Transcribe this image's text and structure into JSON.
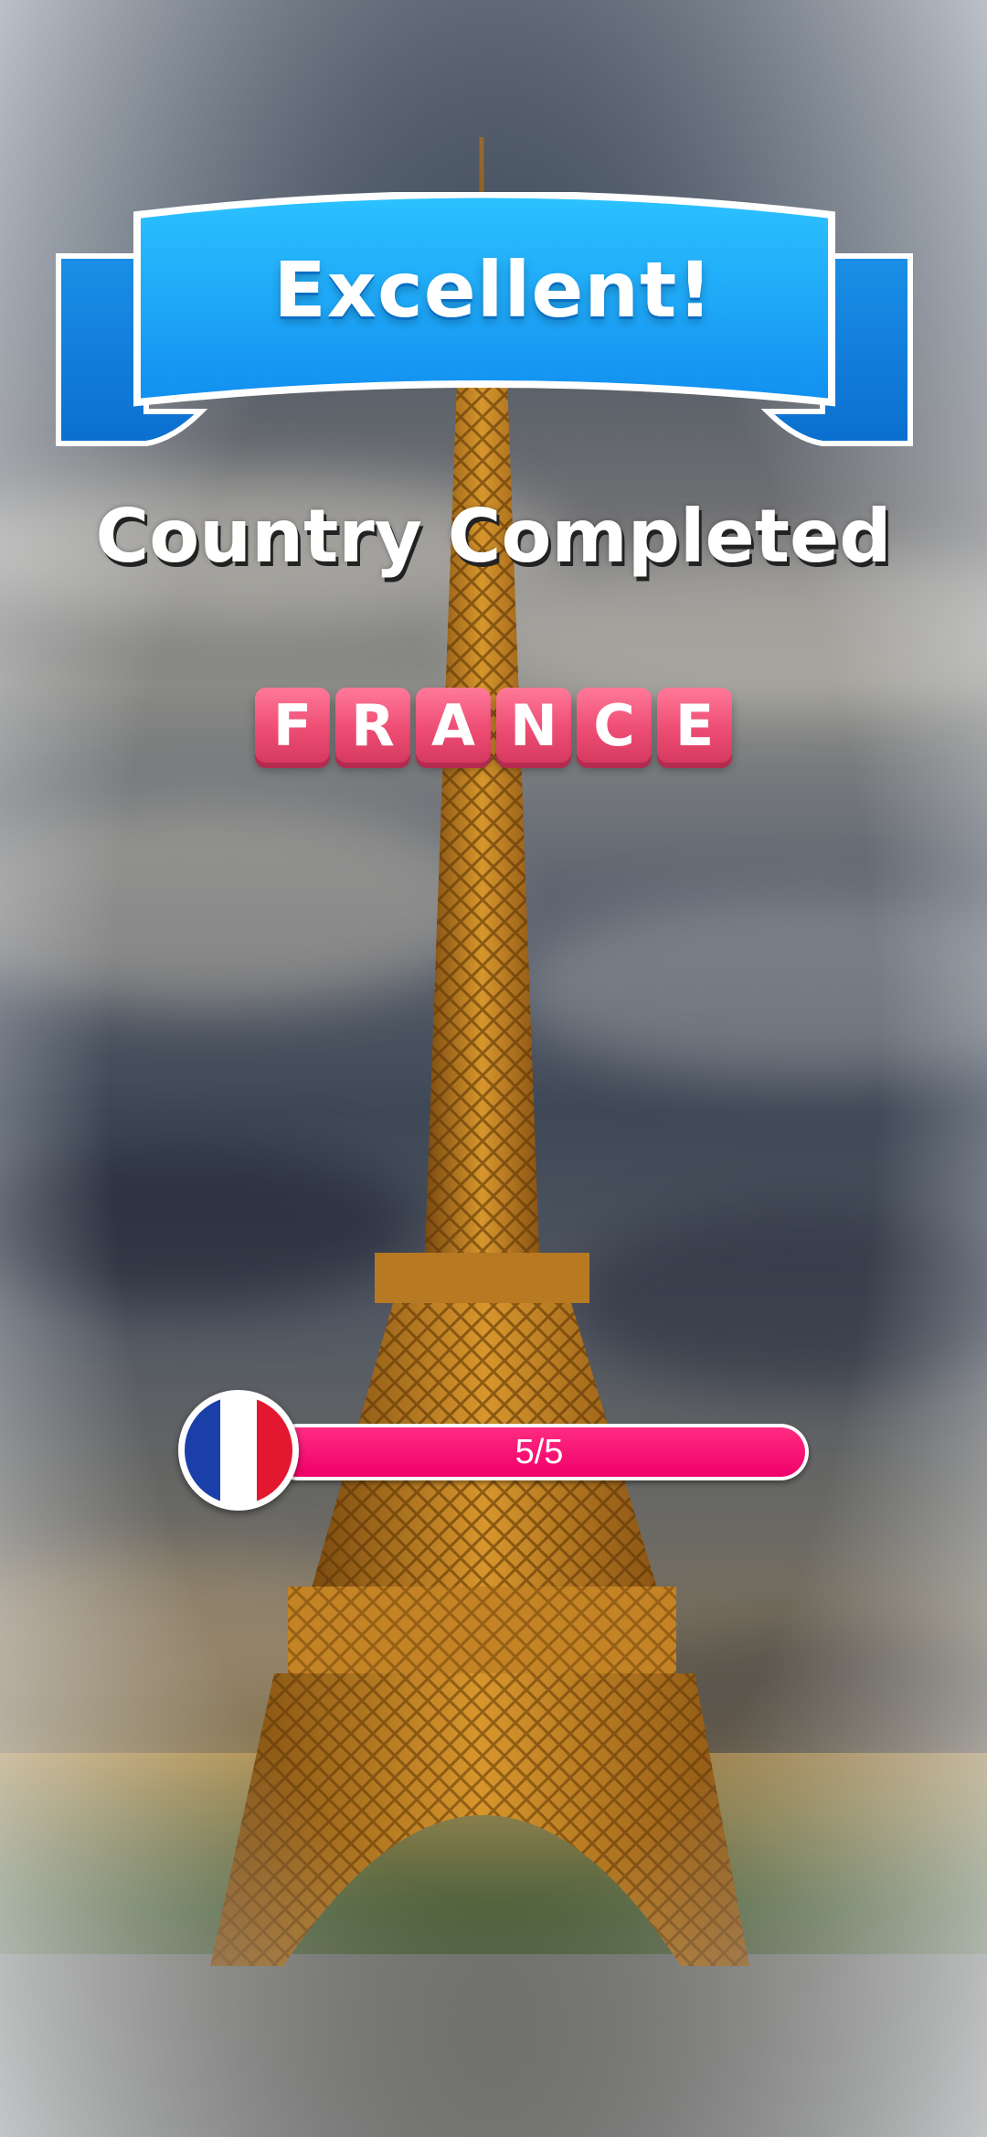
{
  "banner": {
    "title": "Excellent!"
  },
  "subtitle": "Country Completed",
  "country": {
    "letters": [
      "F",
      "R",
      "A",
      "N",
      "C",
      "E"
    ]
  },
  "progress": {
    "label": "5/5",
    "completed": 5,
    "total": 5,
    "fraction": 1.0
  },
  "flag": {
    "colors": [
      "#1b3fa8",
      "#ffffff",
      "#e3172f"
    ]
  },
  "colors": {
    "ribbon": "#21a9f7",
    "tile": "#ee4d74",
    "bar": "#f0006a"
  }
}
